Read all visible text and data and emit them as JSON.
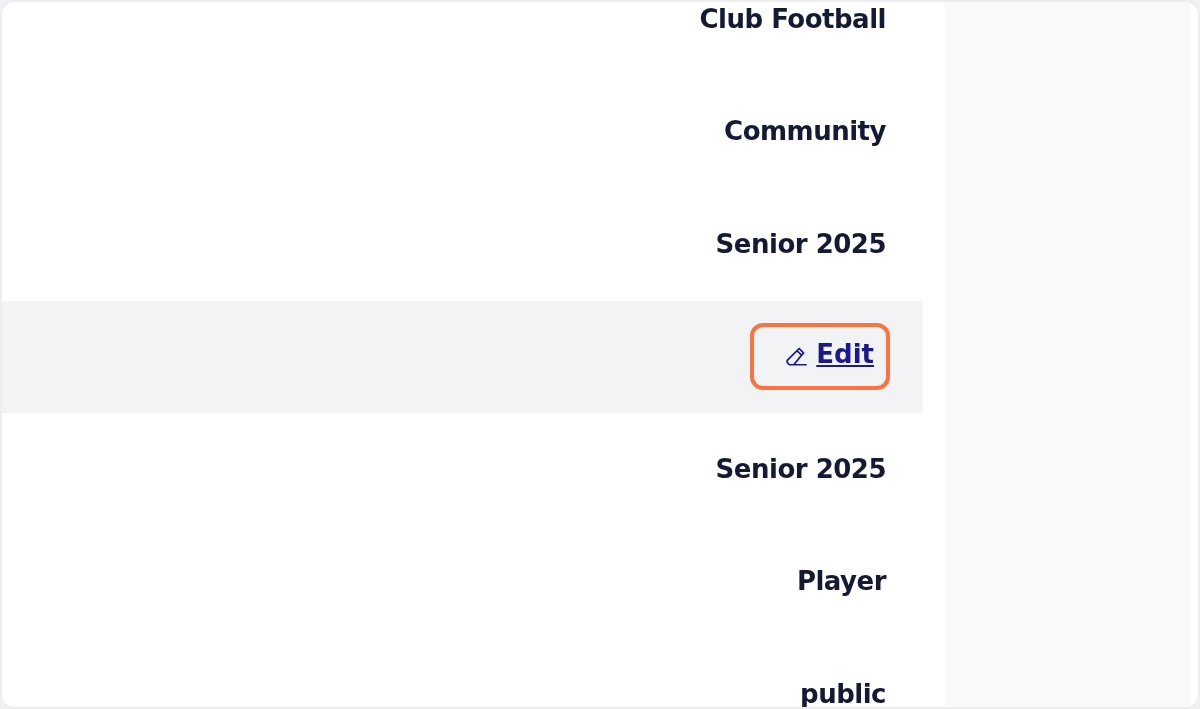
{
  "rows": [
    {
      "kind": "text",
      "text": "Club Football",
      "highlighted": false
    },
    {
      "kind": "text",
      "text": "Community",
      "highlighted": false
    },
    {
      "kind": "text",
      "text": "Senior 2025",
      "highlighted": false
    },
    {
      "kind": "link",
      "text": "Edit",
      "highlighted": true
    },
    {
      "kind": "text",
      "text": "Senior 2025",
      "highlighted": false
    },
    {
      "kind": "text",
      "text": "Player",
      "highlighted": false
    },
    {
      "kind": "text",
      "text": "public",
      "highlighted": false
    }
  ]
}
